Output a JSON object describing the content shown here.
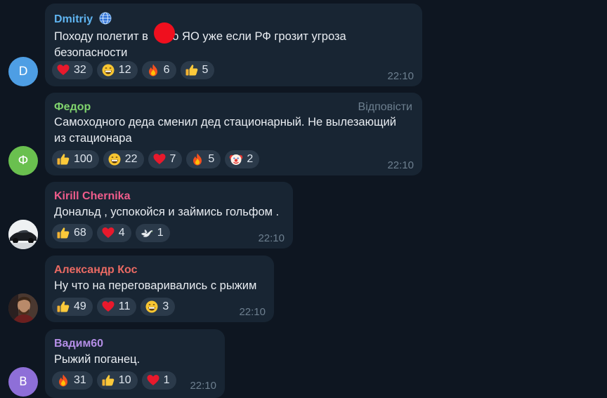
{
  "colors": {
    "background": "#0e1621",
    "bubble": "#182533",
    "reaction_chip": "#2b3a4a",
    "time": "#6d7f8f"
  },
  "messages": [
    {
      "sender": "Dmitriy",
      "sender_badge": "globe-icon",
      "sender_color": "#5fb4f0",
      "avatar_letter": "D",
      "avatar_color": "#4e9ee4",
      "text_lines": [
        "Походу полетит в ",
        "ло ЯО уже если РФ грозит угроза",
        "безопасности"
      ],
      "reactions": [
        {
          "emoji": "heart",
          "count": "32"
        },
        {
          "emoji": "grin",
          "count": "12"
        },
        {
          "emoji": "fire",
          "count": "6"
        },
        {
          "emoji": "thumbs-up",
          "count": "5"
        }
      ],
      "time": "22:10"
    },
    {
      "sender": "Федор",
      "sender_color": "#7fd36d",
      "avatar_letter": "Ф",
      "avatar_color": "#6ac04f",
      "reply_label": "Відповісти",
      "text_lines": [
        "Самоходного деда сменил дед стационарный. Не вылезающий",
        "из стационара"
      ],
      "reactions": [
        {
          "emoji": "thumbs-up",
          "count": "100"
        },
        {
          "emoji": "grin",
          "count": "22"
        },
        {
          "emoji": "heart",
          "count": "7"
        },
        {
          "emoji": "fire",
          "count": "5"
        },
        {
          "emoji": "clown",
          "count": "2"
        }
      ],
      "time": "22:10"
    },
    {
      "sender": "Kirill Chernika",
      "sender_color": "#ef5c8b",
      "avatar_image": "car-photo",
      "text_lines": [
        "Дональд , успокойся и займись гольфом ."
      ],
      "reactions": [
        {
          "emoji": "thumbs-up",
          "count": "68"
        },
        {
          "emoji": "heart",
          "count": "4"
        },
        {
          "emoji": "dove",
          "count": "1"
        }
      ],
      "time": "22:10"
    },
    {
      "sender": "Александр Кос",
      "sender_color": "#ea6a63",
      "avatar_image": "person-photo",
      "text_lines": [
        "Ну что на переговаривались с рыжим"
      ],
      "reactions": [
        {
          "emoji": "thumbs-up",
          "count": "49"
        },
        {
          "emoji": "heart",
          "count": "11"
        },
        {
          "emoji": "grin",
          "count": "3"
        }
      ],
      "time": "22:10"
    },
    {
      "sender": "Вадим60",
      "sender_color": "#b48ee6",
      "avatar_letter": "В",
      "avatar_color": "#8e6fd8",
      "text_lines": [
        "Рыжий поганец."
      ],
      "reactions": [
        {
          "emoji": "fire",
          "count": "31"
        },
        {
          "emoji": "thumbs-up",
          "count": "10"
        },
        {
          "emoji": "heart",
          "count": "1"
        }
      ],
      "time": "22:10"
    }
  ]
}
